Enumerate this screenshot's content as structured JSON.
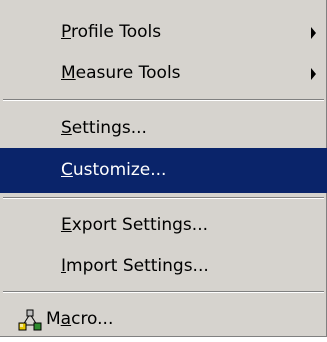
{
  "menu": {
    "items": [
      {
        "id": "profile-tools",
        "pre": "",
        "mnemonic": "P",
        "post": "rofile Tools",
        "submenu": true
      },
      {
        "id": "measure-tools",
        "pre": "",
        "mnemonic": "M",
        "post": "easure Tools",
        "submenu": true
      },
      {
        "id": "settings",
        "pre": "",
        "mnemonic": "S",
        "post": "ettings...",
        "submenu": false
      },
      {
        "id": "customize",
        "pre": "",
        "mnemonic": "C",
        "post": "ustomize...",
        "submenu": false,
        "highlighted": true
      },
      {
        "id": "export-settings",
        "pre": "",
        "mnemonic": "E",
        "post": "xport Settings...",
        "submenu": false
      },
      {
        "id": "import-settings",
        "pre": "",
        "mnemonic": "I",
        "post": "mport Settings...",
        "submenu": false
      },
      {
        "id": "macro",
        "pre": "M",
        "mnemonic": "a",
        "post": "cro...",
        "submenu": false,
        "icon": "macro-icon"
      }
    ]
  },
  "colors": {
    "menu_bg": "#d6d3ce",
    "highlight_bg": "#0a246a",
    "highlight_text": "#ffffff",
    "text": "#000000"
  }
}
